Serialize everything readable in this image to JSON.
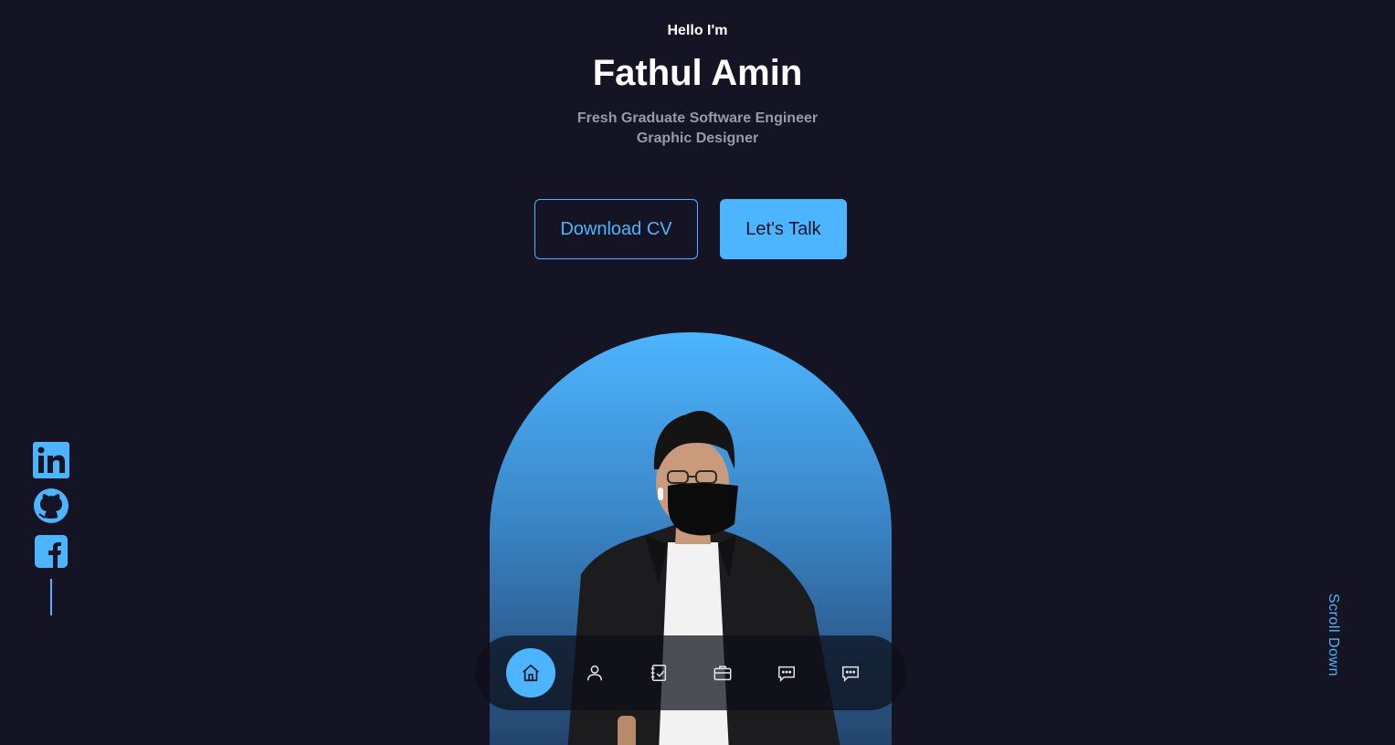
{
  "hero": {
    "greeting": "Hello I'm",
    "name": "Fathul Amin",
    "roles": [
      "Fresh Graduate Software Engineer",
      "Graphic Designer"
    ]
  },
  "buttons": {
    "download_cv": "Download CV",
    "lets_talk": "Let's Talk"
  },
  "socials": [
    {
      "icon": "linkedin-icon"
    },
    {
      "icon": "github-icon"
    },
    {
      "icon": "facebook-icon"
    }
  ],
  "scroll_label": "Scroll Down",
  "nav": {
    "items": [
      {
        "icon": "home-icon",
        "active": true
      },
      {
        "icon": "user-icon",
        "active": false
      },
      {
        "icon": "notes-icon",
        "active": false
      },
      {
        "icon": "briefcase-icon",
        "active": false
      },
      {
        "icon": "message-icon",
        "active": false
      },
      {
        "icon": "message-icon",
        "active": false
      }
    ]
  },
  "colors": {
    "background": "#151425",
    "accent": "#4db5ff",
    "muted_text": "#9a9aa6"
  }
}
